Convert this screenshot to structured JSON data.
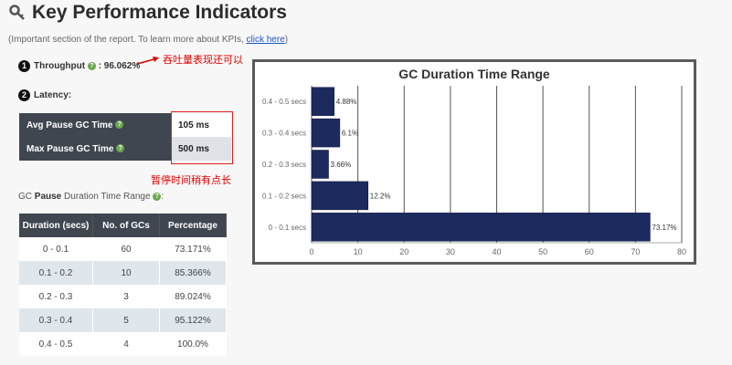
{
  "page": {
    "title": "Key Performance Indicators",
    "subtitle_prefix": "(Important section of the report. To learn more about KPIs,",
    "subtitle_link": "click here",
    "subtitle_suffix": ")"
  },
  "throughput": {
    "number": "1",
    "label": "Throughput",
    "value": ": 96.062%",
    "annotation": "吞吐量表现还可以"
  },
  "latency": {
    "number": "2",
    "label": "Latency:",
    "annotation": "暂停时间稍有点长",
    "rows": [
      {
        "label": "Avg Pause GC Time",
        "value": "105 ms"
      },
      {
        "label": "Max Pause GC Time",
        "value": "500 ms"
      }
    ]
  },
  "gc_range": {
    "prefix": "GC",
    "bold": "Pause",
    "suffix": "Duration Time Range",
    "columns": [
      "Duration (secs)",
      "No. of GCs",
      "Percentage"
    ],
    "rows": [
      [
        "0 - 0.1",
        "60",
        "73.171%"
      ],
      [
        "0.1 - 0.2",
        "10",
        "85.366%"
      ],
      [
        "0.2 - 0.3",
        "3",
        "89.024%"
      ],
      [
        "0.3 - 0.4",
        "5",
        "95.122%"
      ],
      [
        "0.4 - 0.5",
        "4",
        "100.0%"
      ]
    ]
  },
  "colors": {
    "bar": "#1c2a5e",
    "header_bg": "#3f4650",
    "annotation": "#e00000",
    "link": "#1a55c8"
  },
  "chart_data": {
    "type": "bar",
    "orientation": "horizontal",
    "title": "GC Duration Time Range",
    "categories": [
      "0.4 - 0.5 secs",
      "0.3 - 0.4 secs",
      "0.2 - 0.3 secs",
      "0.1 - 0.2 secs",
      "0 - 0.1 secs"
    ],
    "values": [
      4.88,
      6.1,
      3.66,
      12.2,
      73.17
    ],
    "labels": [
      "4.88%",
      "6.1%",
      "3.66%",
      "12.2%",
      "73.17%"
    ],
    "xlim": [
      0,
      80
    ],
    "xticks": [
      "0",
      "10",
      "20",
      "30",
      "40",
      "50",
      "60",
      "70",
      "80"
    ],
    "grid": true
  }
}
